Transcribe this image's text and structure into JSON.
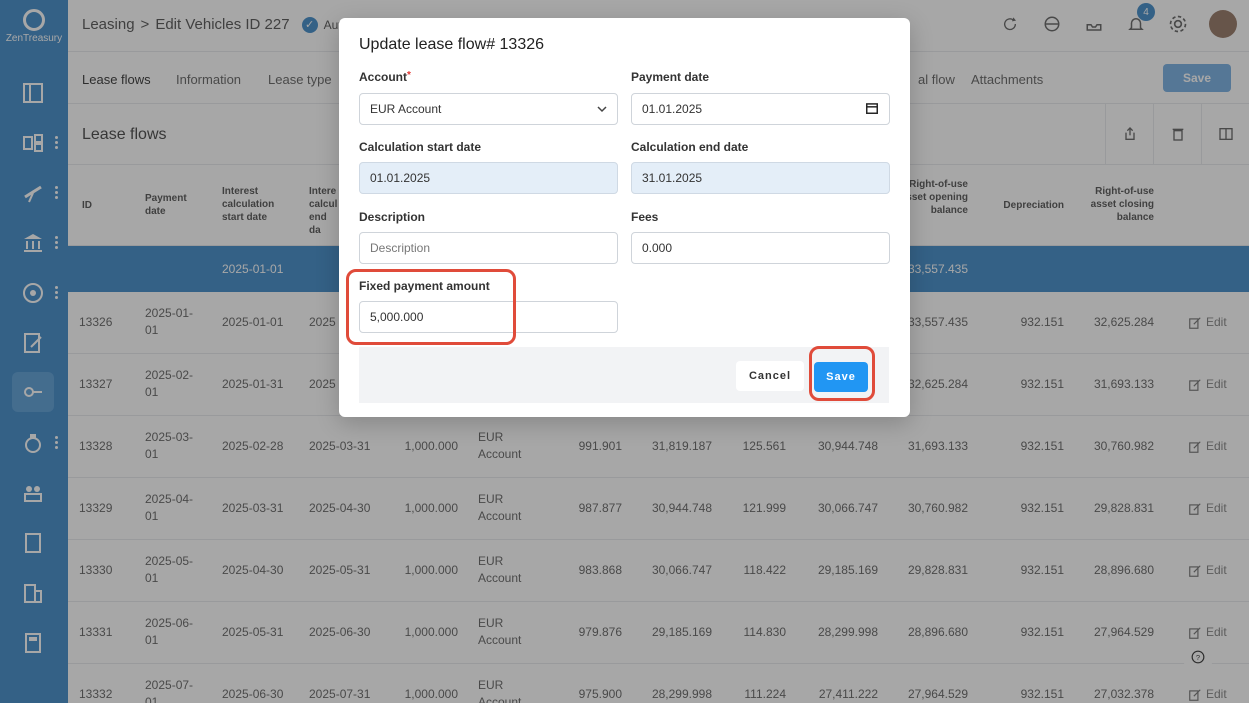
{
  "app": {
    "logo_text": "ZenTreasury"
  },
  "header": {
    "breadcrumb_root": "Leasing",
    "breadcrumb_sep": ">",
    "breadcrumb_page": "Edit Vehicles ID 227",
    "auto_label": "Auto a",
    "notification_count": "4"
  },
  "tabs": {
    "items": [
      "Lease flows",
      "Information",
      "Lease type",
      "al flow",
      "Attachments"
    ],
    "save_label": "Save"
  },
  "section": {
    "title": "Lease flows"
  },
  "table": {
    "headers": [
      "ID",
      "Payment date",
      "Interest calculation start date",
      "Intere calcul end da",
      "Right-of-use asset opening balance",
      "Depreciation",
      "Right-of-use asset closing balance"
    ],
    "highlight_row": {
      "start": "2025-01-01",
      "rou_open": "33,557.435"
    },
    "rows": [
      {
        "id": "13326",
        "pay": "2025-01-01",
        "start": "2025-01-01",
        "end": "2025",
        "amt": "",
        "acc": "",
        "interest": "",
        "bal": "",
        "intamt": "",
        "close": "",
        "rou_open": "33,557.435",
        "dep": "932.151",
        "rou_close": "32,625.284",
        "edit": "Edit"
      },
      {
        "id": "13327",
        "pay": "2025-02-01",
        "start": "2025-01-31",
        "end": "2025",
        "amt": "",
        "acc": "",
        "interest": "",
        "bal": "",
        "intamt": "",
        "close": "",
        "rou_open": "32,625.284",
        "dep": "932.151",
        "rou_close": "31,693.133",
        "edit": "Edit"
      },
      {
        "id": "13328",
        "pay": "2025-03-01",
        "start": "2025-02-28",
        "end": "2025-03-31",
        "amt": "1,000.000",
        "acc": "EUR Account",
        "interest": "991.901",
        "bal": "31,819.187",
        "intamt": "125.561",
        "close": "30,944.748",
        "rou_open": "31,693.133",
        "dep": "932.151",
        "rou_close": "30,760.982",
        "edit": "Edit"
      },
      {
        "id": "13329",
        "pay": "2025-04-01",
        "start": "2025-03-31",
        "end": "2025-04-30",
        "amt": "1,000.000",
        "acc": "EUR Account",
        "interest": "987.877",
        "bal": "30,944.748",
        "intamt": "121.999",
        "close": "30,066.747",
        "rou_open": "30,760.982",
        "dep": "932.151",
        "rou_close": "29,828.831",
        "edit": "Edit"
      },
      {
        "id": "13330",
        "pay": "2025-05-01",
        "start": "2025-04-30",
        "end": "2025-05-31",
        "amt": "1,000.000",
        "acc": "EUR Account",
        "interest": "983.868",
        "bal": "30,066.747",
        "intamt": "118.422",
        "close": "29,185.169",
        "rou_open": "29,828.831",
        "dep": "932.151",
        "rou_close": "28,896.680",
        "edit": "Edit"
      },
      {
        "id": "13331",
        "pay": "2025-06-01",
        "start": "2025-05-31",
        "end": "2025-06-30",
        "amt": "1,000.000",
        "acc": "EUR Account",
        "interest": "979.876",
        "bal": "29,185.169",
        "intamt": "114.830",
        "close": "28,299.998",
        "rou_open": "28,896.680",
        "dep": "932.151",
        "rou_close": "27,964.529",
        "edit": "Edit"
      },
      {
        "id": "13332",
        "pay": "2025-07-01",
        "start": "2025-06-30",
        "end": "2025-07-31",
        "amt": "1,000.000",
        "acc": "EUR Account",
        "interest": "975.900",
        "bal": "28,299.998",
        "intamt": "111.224",
        "close": "27,411.222",
        "rou_open": "27,964.529",
        "dep": "932.151",
        "rou_close": "27,032.378",
        "edit": "Edit"
      }
    ]
  },
  "modal": {
    "title": "Update lease flow# 13326",
    "account_label": "Account",
    "account_required": "*",
    "account_value": "EUR Account",
    "payment_date_label": "Payment date",
    "payment_date_value": "01.01.2025",
    "calc_start_label": "Calculation start date",
    "calc_start_value": "01.01.2025",
    "calc_end_label": "Calculation end date",
    "calc_end_value": "31.01.2025",
    "description_label": "Description",
    "description_placeholder": "Description",
    "fees_label": "Fees",
    "fees_value": "0.000",
    "fixed_payment_label": "Fixed payment amount",
    "fixed_payment_value": "5,000.000",
    "cancel_label": "Cancel",
    "save_label": "Save"
  },
  "colors": {
    "accent": "#2f80c4",
    "save": "#2196f3",
    "highlight_ring": "#e04b3a"
  }
}
